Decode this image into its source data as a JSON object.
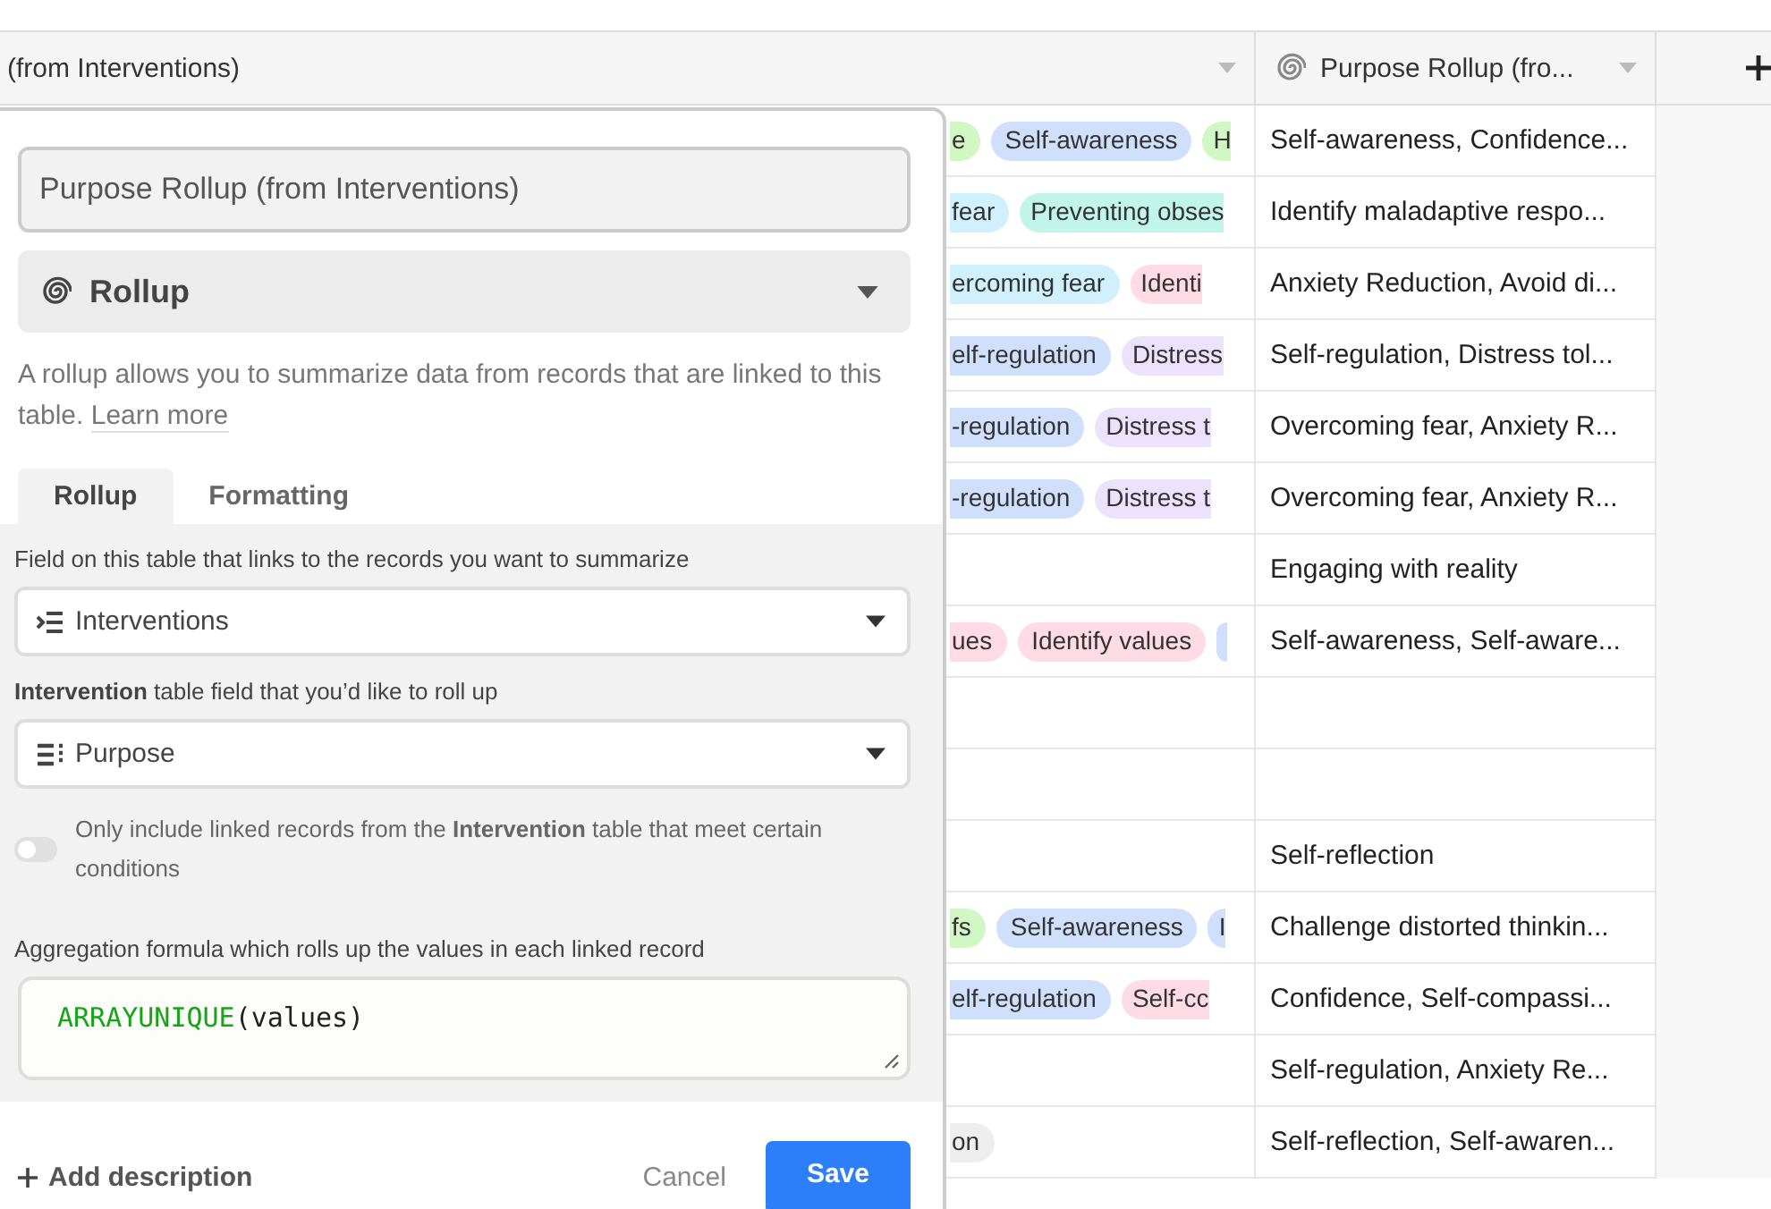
{
  "table": {
    "columns": [
      {
        "kind": "plain",
        "label": "(from Interventions)"
      },
      {
        "kind": "rollup",
        "label": "Purpose Rollup (fro..."
      }
    ],
    "add_column": true,
    "rows": [
      {
        "tags": [
          {
            "text": "e",
            "color": "#d1f7c4"
          },
          {
            "text": "Self-awareness",
            "color": "#d0e0fc"
          },
          {
            "text": "H",
            "color": "#d1f7c4"
          }
        ],
        "rollup": "Self-awareness, Confidence..."
      },
      {
        "tags": [
          {
            "text": "fear",
            "color": "#d0f0fd"
          },
          {
            "text": "Preventing obses",
            "color": "#c2f5e9"
          }
        ],
        "rollup": "Identify maladaptive respo..."
      },
      {
        "tags": [
          {
            "text": "ercoming fear",
            "color": "#d0f0fd"
          },
          {
            "text": "Identi",
            "color": "#ffdce5"
          }
        ],
        "rollup": "Anxiety Reduction, Avoid di..."
      },
      {
        "tags": [
          {
            "text": "elf-regulation",
            "color": "#d0e0fc"
          },
          {
            "text": "Distress",
            "color": "#ede2fe"
          }
        ],
        "rollup": "Self-regulation, Distress tol..."
      },
      {
        "tags": [
          {
            "text": "-regulation",
            "color": "#d0e0fc"
          },
          {
            "text": "Distress t",
            "color": "#ede2fe"
          }
        ],
        "rollup": "Overcoming fear, Anxiety R..."
      },
      {
        "tags": [
          {
            "text": "-regulation",
            "color": "#d0e0fc"
          },
          {
            "text": "Distress t",
            "color": "#ede2fe"
          }
        ],
        "rollup": "Overcoming fear, Anxiety R..."
      },
      {
        "tags": [],
        "rollup": "Engaging with reality"
      },
      {
        "tags": [
          {
            "text": "ues",
            "color": "#ffdce5"
          },
          {
            "text": "Identify values",
            "color": "#ffdce5"
          },
          {
            "color": "#d0e0fc"
          }
        ],
        "rollup": "Self-awareness, Self-aware..."
      },
      {
        "tags": [],
        "rollup": ""
      },
      {
        "tags": [],
        "rollup": ""
      },
      {
        "tags": [],
        "rollup": "Self-reflection"
      },
      {
        "tags": [
          {
            "text": "fs",
            "color": "#d1f7c4"
          },
          {
            "text": "Self-awareness",
            "color": "#d0e0fc"
          },
          {
            "text": "I",
            "color": "#d0e0fc"
          }
        ],
        "rollup": "Challenge distorted thinkin..."
      },
      {
        "tags": [
          {
            "text": "elf-regulation",
            "color": "#d0e0fc"
          },
          {
            "text": "Self-cc",
            "color": "#ffdce5"
          }
        ],
        "rollup": "Confidence, Self-compassi..."
      },
      {
        "tags": [],
        "rollup": "Self-regulation, Anxiety Re..."
      },
      {
        "tags": [
          {
            "text": "on",
            "color": "#eeeeee"
          }
        ],
        "rollup": "Self-reflection, Self-awaren..."
      }
    ]
  },
  "dialog": {
    "field_name": "Purpose Rollup (from Interventions)",
    "field_type": "Rollup",
    "description": "A rollup allows you to summarize data from records that are linked to this table.",
    "learn_more": "Learn more",
    "tabs": [
      {
        "label": "Rollup",
        "selected": true
      },
      {
        "label": "Formatting",
        "selected": false
      }
    ],
    "link_field_label": "Field on this table that links to the records you want to summarize",
    "link_field": "Interventions",
    "rollup_field_label": "**Intervention** table field that you’d like to roll up",
    "rollup_field": "Purpose",
    "condition_toggle": {
      "on": false,
      "label": "Only include linked records from the **Intervention** table that meet certain conditions"
    },
    "formula_label": "Aggregation formula which rolls up the values in each linked record",
    "formula": {
      "function": "ARRAYUNIQUE",
      "argument": "(values)"
    },
    "add_description": "Add description",
    "cancel": "Cancel",
    "save": "Save"
  }
}
